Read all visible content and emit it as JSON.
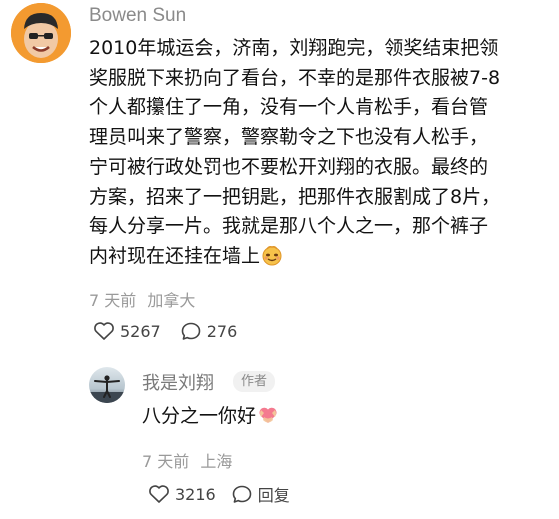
{
  "comment": {
    "author": "Bowen Sun",
    "body_lines": [
      "2010年城运会，济南，刘翔跑完，领奖结束把领",
      "奖服脱下来扔向了看台，不幸的是那件衣服被7-8",
      "个人都攥住了一角，没有一个人肯松手，看台管",
      "理员叫来了警察，警察勒令之下也没有人松手，",
      "宁可被行政处罚也不要松开刘翔的衣服。最终的",
      "方案，招来了一把钥匙，把那件衣服割成了8片，",
      "每人分享一片。我就是那八个人之一，那个裤子",
      "内衬现在还挂在墙上"
    ],
    "emoji": "smirk-face-emoji",
    "time": "7 天前",
    "location": "加拿大",
    "likes": "5267",
    "replies": "276"
  },
  "reply": {
    "author": "我是刘翔",
    "badge": "作者",
    "body": "八分之一你好",
    "emoji": "heart-hands-emoji",
    "time": "7 天前",
    "location": "上海",
    "likes": "3216",
    "reply_label": "回复"
  },
  "colors": {
    "text_primary": "#121212",
    "text_secondary": "#9a9a9a",
    "badge_bg": "#f1f1f1",
    "heart_pink": "#f47a8f"
  },
  "icons": {
    "like": "heart-outline-icon",
    "comment": "speech-bubble-icon"
  }
}
